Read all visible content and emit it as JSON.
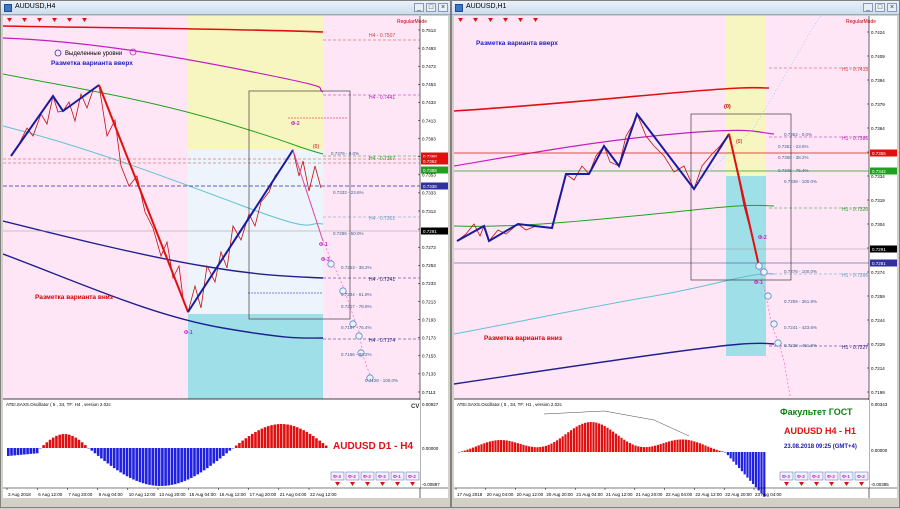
{
  "left": {
    "title": "AUDUSD,H4",
    "mode_label": "RegularMode",
    "legend_label": "Выделенные уровни",
    "up_variant": "Разметка варианта вверх",
    "down_variant": "Разметка варианта вниз",
    "osc_label": "ATEI.SAXS.Oscillator ( 5 , 34, TF: H4 , version 2.02c",
    "cv_label": "CV",
    "big_label": "AUDUSD D1 - H4",
    "zero_mark": "(0)",
    "phi_labels": [
      "Ф-2",
      "Ф-1",
      "Ф-3",
      "Ф-1"
    ],
    "right_axis": [
      "0.7513",
      "0.7493",
      "0.7473",
      "0.7453",
      "0.7433",
      "0.7413",
      "0.7393",
      "0.7373",
      "0.7353",
      "0.7333",
      "0.7313",
      "0.7293",
      "0.7273",
      "0.7253",
      "0.7233",
      "0.7213",
      "0.7193",
      "0.7173",
      "0.7153",
      "0.7133",
      "0.7113"
    ],
    "price_tags": [
      "0.7368",
      "0.7362",
      "0.7358",
      "0.7338",
      "0.7291"
    ],
    "osc_axis": [
      "0.00927",
      "0.00000",
      "-0.00897"
    ],
    "levels": [
      {
        "text": "H4 - 0.7507",
        "color": "#d04040"
      },
      {
        "text": "H4 - 0.7441",
        "color": "#b020b0"
      },
      {
        "text": "H4 - 0.7367",
        "color": "#20a020"
      },
      {
        "text": "H4 - 0.7301",
        "color": "#60a0c0"
      },
      {
        "text": "H4 - 0.7241",
        "color": "#202080"
      },
      {
        "text": "H4 - 0.7174",
        "color": "#202080"
      }
    ],
    "fib": [
      "0.7376 - 0.0%",
      "0.7333 - 23.6%",
      "0.7286 - 50.0%",
      "0.7253 - 38.2%",
      "0.7234 - 61.8%",
      "0.7207 - 78.6%",
      "0.7187 - 76.4%",
      "0.7156 - 88.2%",
      "0.7128 - 100.0%"
    ],
    "dates": [
      "3 Aug 2018",
      "6 Aug 12:00",
      "7 Aug 20:00",
      "9 Aug 04:00",
      "10 Aug 12:00",
      "13 Aug 20:00",
      "15 Aug 04:00",
      "16 Aug 12:00",
      "17 Aug 20:00",
      "21 Aug 04:00",
      "22 Aug 12:00"
    ],
    "buttons": [
      "Ф-3",
      "Ф-2",
      "Ф-2",
      "Ф-2",
      "Ф-1",
      "Ф-2"
    ]
  },
  "right": {
    "title": "AUDUSD,H1",
    "mode_label": "RegularMode",
    "up_variant": "Разметка варианта вверх",
    "down_variant": "Разметка варианта вниз",
    "osc_label": "ATEI.SAXS.Oscillator ( 5 , 34, TF: H1 , version 2.02c",
    "faculty": "Факультет ГОСТ",
    "big_label": "AUDUSD H4 - H1",
    "datetime": "23.08.2018 09:25 (GMT+4)",
    "zero_mark": "(0)",
    "zero_mark2": "(0)",
    "phi_labels": [
      "Ф-2",
      "Ф-1"
    ],
    "right_axis": [
      "0.7424",
      "0.7409",
      "0.7394",
      "0.7379",
      "0.7364",
      "0.7349",
      "0.7334",
      "0.7319",
      "0.7304",
      "0.7289",
      "0.7274",
      "0.7259",
      "0.7244",
      "0.7229",
      "0.7214",
      "0.7199"
    ],
    "price_tags": [
      "0.7355",
      "0.7342",
      "0.7291",
      "0.7281"
    ],
    "osc_axis": [
      "0.00343",
      "0.00000",
      "-0.00385"
    ],
    "levels": [
      {
        "text": "H1 - 0.7413",
        "color": "#d04040"
      },
      {
        "text": "H1 - 0.7386",
        "color": "#b020b0"
      },
      {
        "text": "H1 - 0.7320",
        "color": "#20a020"
      },
      {
        "text": "H1 - 0.7266",
        "color": "#60a0c0"
      },
      {
        "text": "H1 - 0.7227",
        "color": "#202080"
      }
    ],
    "fib": [
      "0.7362 - 0.0%",
      "0.7361 - 23.6%",
      "0.7350 - 38.2%",
      "0.7345 - 76.4%",
      "0.7338 - 100.0%",
      "0.7276 - 100.0%",
      "0.7259 - 361.8%",
      "0.7241 - 423.6%",
      "0.7228 - 461.8%"
    ],
    "dates": [
      "17 Aug 2018",
      "20 Aug 04:00",
      "20 Aug 12:00",
      "20 Aug 20:00",
      "21 Aug 04:00",
      "21 Aug 12:00",
      "21 Aug 20:00",
      "22 Aug 04:00",
      "22 Aug 12:00",
      "22 Aug 20:00",
      "23 Aug 04:00"
    ],
    "buttons": [
      "Ф-3",
      "Ф-2",
      "Ф-2",
      "Ф-2",
      "Ф-1",
      "Ф-2"
    ]
  },
  "colors": {
    "background": "#ffe6f6",
    "yellow_zone": "#f8f6c0",
    "blue_zone": "#eef4fb",
    "cyan_zone": "#9fe0e8",
    "up_line": "#1a1aa0",
    "down_line": "#e01010",
    "histogram_up": "#e01010",
    "histogram_down": "#2020e0"
  }
}
